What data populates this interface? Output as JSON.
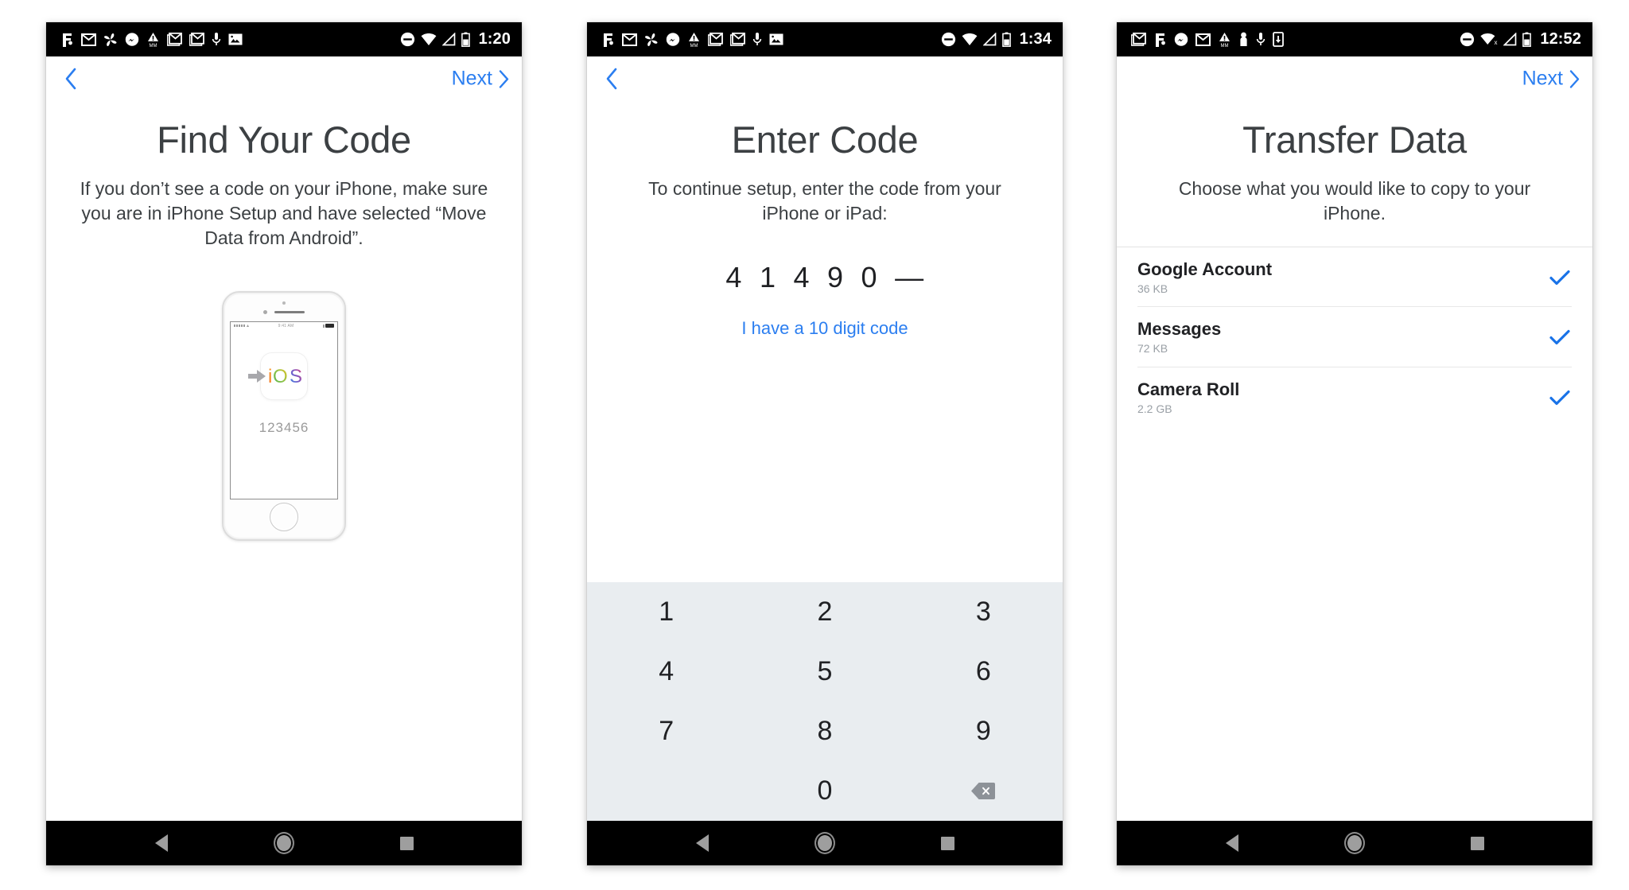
{
  "meta": {
    "app": "Move to iOS",
    "accent_blue": "#2b7ef0",
    "keypad_bg": "#e9edf0",
    "text_dark": "#3c4043",
    "muted_gray": "#9aa0a6"
  },
  "panels": [
    {
      "id": "find-your-code",
      "statusbar": {
        "time": "1:20",
        "left_icons": [
          "fi-icon",
          "gmail-icon",
          "photos-icon",
          "messenger-icon",
          "mm-alert-icon",
          "gmail-stack-icon",
          "gmail-stack2-icon",
          "mic-icon",
          "image-icon"
        ],
        "right_icons": [
          "do-not-disturb-icon",
          "wifi-icon",
          "signal-icon",
          "battery-icon"
        ]
      },
      "appbar": {
        "back_icon": "chevron-left-icon",
        "next_label": "Next",
        "next_icon": "chevron-right-icon",
        "has_next": true
      },
      "title": "Find Your Code",
      "subtitle": "If you don’t see a code on your iPhone, make sure you are in iPhone Setup and have selected “Move Data from Android”.",
      "illustration": {
        "device": "iphone-illustration",
        "app_icon_label": "iOS",
        "arrow_icon": "right-arrow-icon",
        "pairing_code": "123456",
        "phone_status_clock": "9:41 AM"
      }
    },
    {
      "id": "enter-code",
      "statusbar": {
        "time": "1:34",
        "left_icons": [
          "fi-icon",
          "gmail-icon",
          "photos-icon",
          "messenger-icon",
          "mm-alert-icon",
          "gmail-stack-icon",
          "gmail-stack2-icon",
          "mic-icon",
          "image-icon"
        ],
        "right_icons": [
          "do-not-disturb-icon",
          "wifi-icon",
          "signal-icon",
          "battery-icon"
        ]
      },
      "appbar": {
        "back_icon": "chevron-left-icon",
        "next_label": "",
        "next_icon": "",
        "has_next": false
      },
      "title": "Enter Code",
      "subtitle": "To continue setup, enter the code from your iPhone or iPad:",
      "code": {
        "digits": [
          "4",
          "1",
          "4",
          "9",
          "0"
        ],
        "placeholder_glyph": "—",
        "link_label": "I have a 10 digit code"
      },
      "keypad": {
        "keys": [
          "1",
          "2",
          "3",
          "4",
          "5",
          "6",
          "7",
          "8",
          "9",
          "",
          "0",
          ""
        ],
        "backspace_icon": "backspace-icon"
      }
    },
    {
      "id": "transfer-data",
      "statusbar": {
        "time": "12:52",
        "left_icons": [
          "gmail-stack-icon",
          "fi-icon",
          "messenger-icon",
          "gmail-icon",
          "mm-alert-icon",
          "person-icon",
          "mic-icon",
          "device-download-icon"
        ],
        "right_icons": [
          "do-not-disturb-icon",
          "wifi-off-icon",
          "signal-icon",
          "battery-icon"
        ]
      },
      "appbar": {
        "back_icon": "",
        "next_label": "Next",
        "next_icon": "chevron-right-icon",
        "has_next": true,
        "has_back": false
      },
      "title": "Transfer Data",
      "subtitle": "Choose what you would like to copy to your iPhone.",
      "items": [
        {
          "name": "Google Account",
          "size": "36 KB",
          "checked": true,
          "check_icon": "check-icon"
        },
        {
          "name": "Messages",
          "size": "72 KB",
          "checked": true,
          "check_icon": "check-icon"
        },
        {
          "name": "Camera Roll",
          "size": "2.2 GB",
          "checked": true,
          "check_icon": "check-icon"
        }
      ]
    }
  ],
  "navbar": {
    "back_icon": "nav-back-icon",
    "home_icon": "nav-home-icon",
    "recents_icon": "nav-recents-icon"
  }
}
